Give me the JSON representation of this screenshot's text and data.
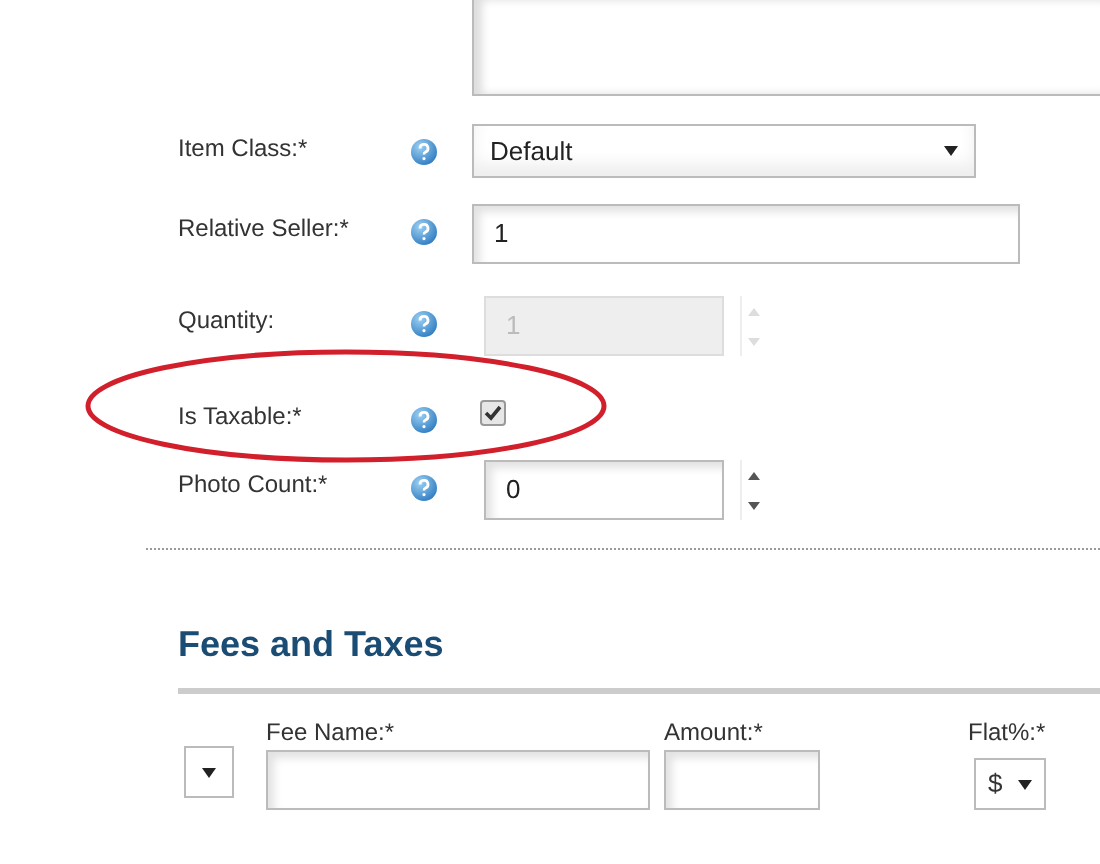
{
  "fields": [
    {
      "label": "Item Class:*",
      "kind": "select",
      "value": "Default",
      "disabled": false
    },
    {
      "label": "Relative Seller:*",
      "kind": "text",
      "value": "1",
      "disabled": false
    },
    {
      "label": "Quantity:",
      "kind": "number",
      "value": "1",
      "disabled": true
    },
    {
      "label": "Is Taxable:*",
      "kind": "checkbox",
      "checked": true,
      "disabled": false
    },
    {
      "label": "Photo Count:*",
      "kind": "number",
      "value": "0",
      "disabled": false
    }
  ],
  "fees_section": {
    "title": "Fees and Taxes",
    "columns": [
      {
        "label": "Fee Name:*"
      },
      {
        "label": "Amount:*"
      },
      {
        "label": "Flat%:*"
      }
    ],
    "row": {
      "flat_percent": "$"
    }
  }
}
